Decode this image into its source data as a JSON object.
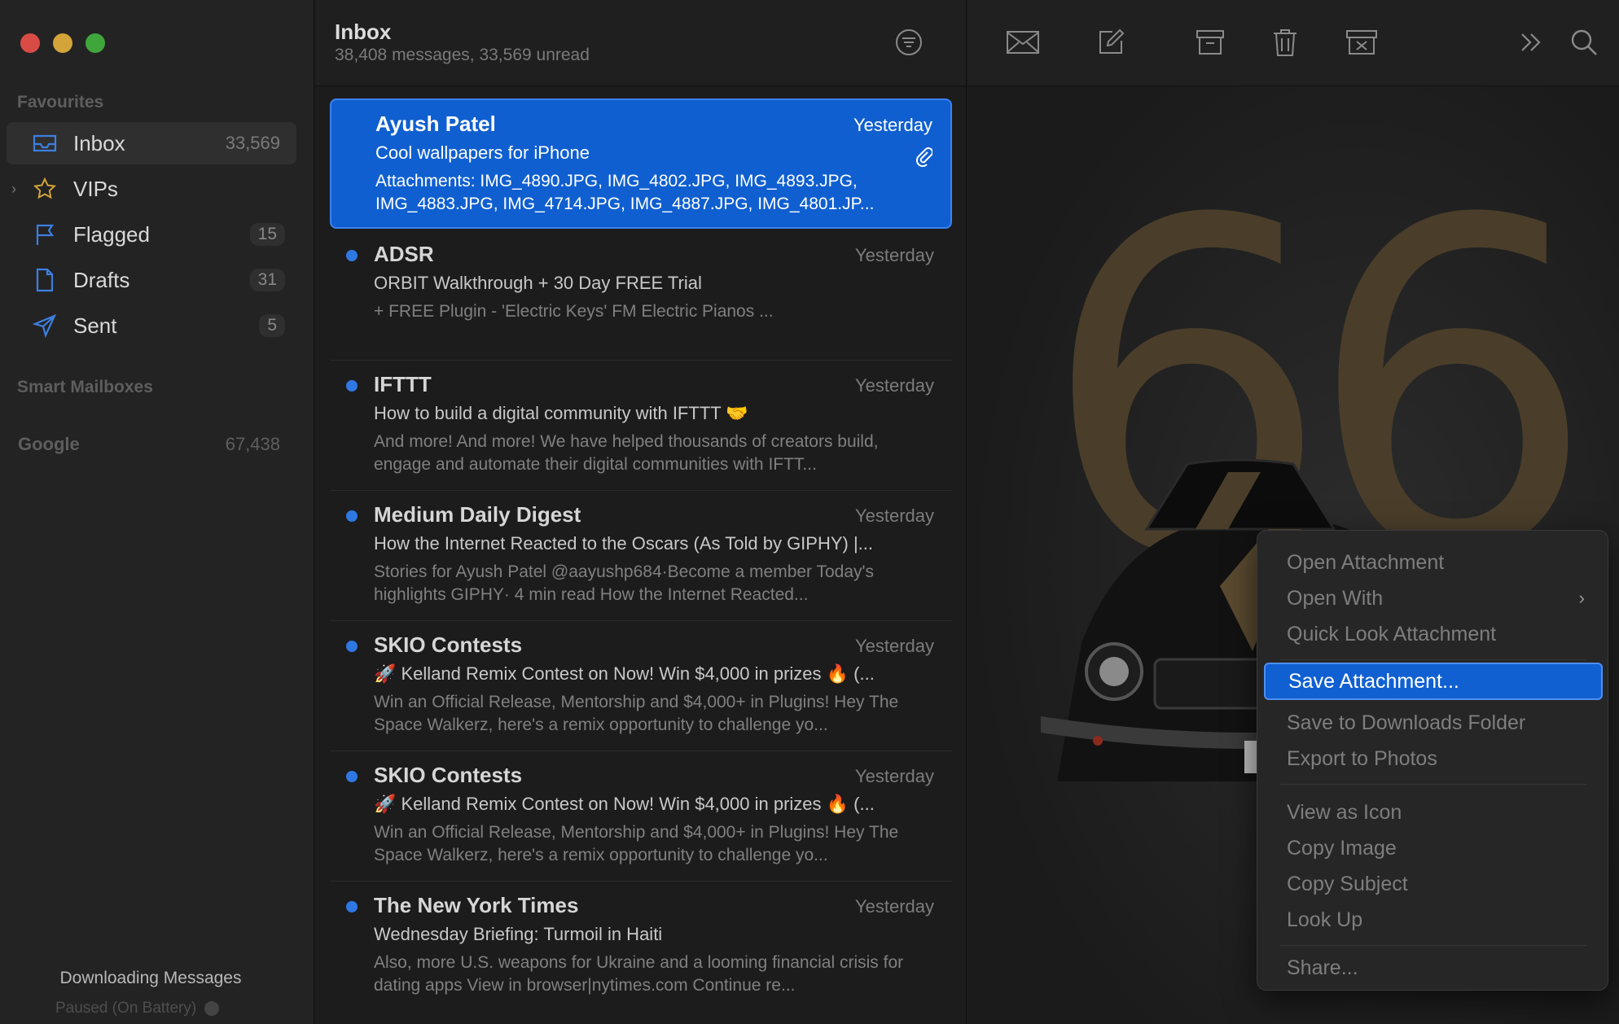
{
  "sidebar": {
    "favourites_label": "Favourites",
    "items": [
      {
        "label": "Inbox",
        "count": "33,569"
      },
      {
        "label": "VIPs",
        "count": ""
      },
      {
        "label": "Flagged",
        "count": "15"
      },
      {
        "label": "Drafts",
        "count": "31"
      },
      {
        "label": "Sent",
        "count": "5"
      }
    ],
    "smart_mailboxes_label": "Smart Mailboxes",
    "account": {
      "label": "Google",
      "count": "67,438"
    },
    "status_line1": "Downloading Messages",
    "status_line2": "Paused (On Battery)"
  },
  "list": {
    "title": "Inbox",
    "subtitle": "38,408 messages, 33,569 unread",
    "messages": [
      {
        "sender": "Ayush Patel",
        "date": "Yesterday",
        "subject": "Cool wallpapers for iPhone",
        "preview": "Attachments: IMG_4890.JPG, IMG_4802.JPG, IMG_4893.JPG, IMG_4883.JPG, IMG_4714.JPG, IMG_4887.JPG, IMG_4801.JP..."
      },
      {
        "sender": "ADSR",
        "date": "Yesterday",
        "subject": "ORBIT Walkthrough + 30 Day FREE Trial",
        "preview": "+ FREE Plugin - 'Electric Keys' FM Electric Pianos ..."
      },
      {
        "sender": "IFTTT",
        "date": "Yesterday",
        "subject": "How to build a digital community with IFTTT 🤝",
        "preview": "And more! And more! We have helped thousands of creators build, engage and automate their digital communities with IFTT..."
      },
      {
        "sender": "Medium Daily Digest",
        "date": "Yesterday",
        "subject": "How the Internet Reacted to the Oscars (As Told by GIPHY) |...",
        "preview": "Stories for Ayush Patel @aayushp684·Become a member Today's highlights GIPHY· 4 min read How the Internet Reacted..."
      },
      {
        "sender": "SKIO Contests",
        "date": "Yesterday",
        "subject": "🚀 Kelland Remix Contest on Now! Win $4,000 in prizes 🔥 (...",
        "preview": "Win an Official Release, Mentorship and $4,000+ in Plugins! Hey The Space Walkerz, here's a remix opportunity to challenge yo..."
      },
      {
        "sender": "SKIO Contests",
        "date": "Yesterday",
        "subject": "🚀 Kelland Remix Contest on Now! Win $4,000 in prizes 🔥 (...",
        "preview": "Win an Official Release, Mentorship and $4,000+ in Plugins! Hey The Space Walkerz, here's a remix opportunity to challenge yo..."
      },
      {
        "sender": "The New York Times",
        "date": "Yesterday",
        "subject": "Wednesday Briefing: Turmoil in Haiti",
        "preview": "Also, more U.S. weapons for Ukraine and a looming financial crisis for dating apps View in browser|nytimes.com Continue re..."
      }
    ]
  },
  "reader": {
    "wallpaper_text": "66"
  },
  "context_menu": {
    "items": [
      "Open Attachment",
      "Open With",
      "Quick Look Attachment",
      "Save Attachment...",
      "Save to Downloads Folder",
      "Export to Photos",
      "View as Icon",
      "Copy Image",
      "Copy Subject",
      "Look Up",
      "Share..."
    ]
  },
  "colors": {
    "accent": "#0f5fd0",
    "unread_dot": "#2f78e4"
  }
}
